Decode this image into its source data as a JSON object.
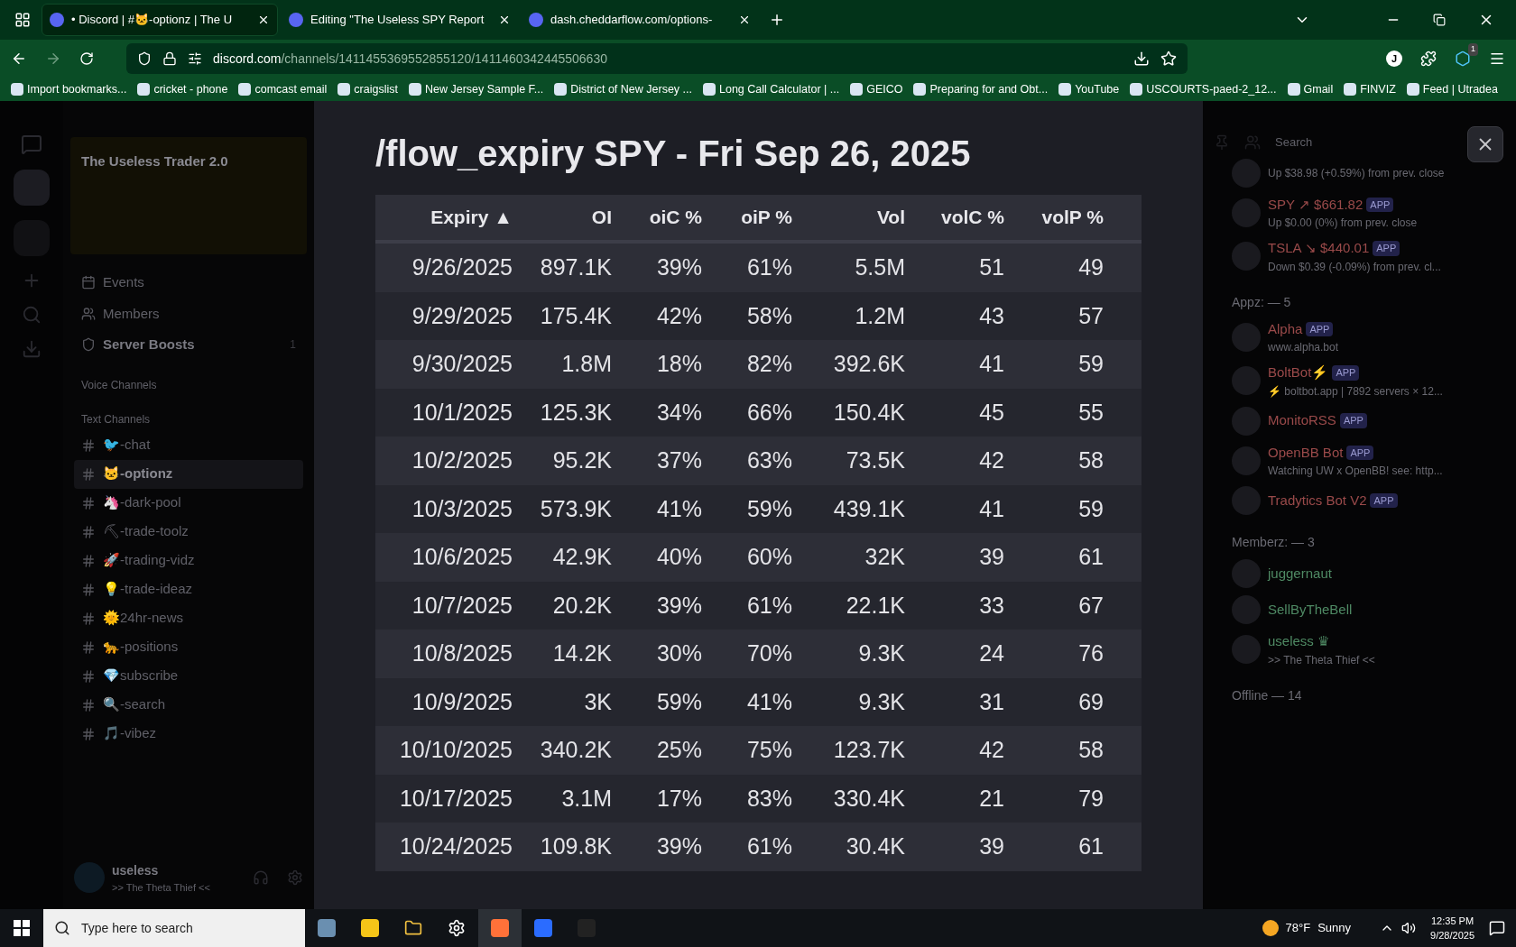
{
  "browser": {
    "tabs": [
      {
        "title": "• Discord | #🐱-optionz | The U",
        "selected": true
      },
      {
        "title": "Editing \"The Useless SPY Report",
        "selected": false
      },
      {
        "title": "dash.cheddarflow.com/options-",
        "selected": false
      }
    ],
    "url": {
      "domain": "discord.com",
      "path": "/channels/1411455369552855120/1411460342445506630"
    },
    "profile": "J",
    "extension_badge": "1",
    "bookmarks": [
      "Import bookmarks...",
      "cricket - phone",
      "comcast email",
      "craigslist",
      "New Jersey Sample F...",
      "District of New Jersey ...",
      "Long Call Calculator | ...",
      "GEICO",
      "Preparing for and Obt...",
      "YouTube",
      "USCOURTS-paed-2_12...",
      "Gmail",
      "FINVIZ",
      "Feed | Utradea"
    ]
  },
  "discord": {
    "server_name": "The Useless Trader 2.0",
    "server_items": [
      {
        "label": "Events"
      },
      {
        "label": "Members"
      },
      {
        "label": "Server Boosts",
        "count": "1"
      }
    ],
    "voice_header": "Voice Channels",
    "text_header": "Text Channels",
    "channels": [
      {
        "name": "🐦-chat",
        "selected": false
      },
      {
        "name": "🐱-optionz",
        "selected": true
      },
      {
        "name": "🦄-dark-pool",
        "selected": false
      },
      {
        "name": "⛏-trade-toolz",
        "selected": false
      },
      {
        "name": "🚀-trading-vidz",
        "selected": false
      },
      {
        "name": "💡-trade-ideaz",
        "selected": false
      },
      {
        "name": "🌞24hr-news",
        "selected": false
      },
      {
        "name": "🐆-positions",
        "selected": false
      },
      {
        "name": "💎subscribe",
        "selected": false
      },
      {
        "name": "🔍-search",
        "selected": false
      },
      {
        "name": "🎵-vibez",
        "selected": false
      }
    ],
    "user": {
      "name": "useless",
      "status": ">> The Theta Thief <<"
    },
    "search_placeholder": "Search",
    "members": [
      {
        "kind": "ticker",
        "sub": "Up $38.98 (+0.59%) from prev. close"
      },
      {
        "kind": "ticker",
        "name": "SPY ↗ $661.82",
        "tag": "APP",
        "sub": "Up $0.00 (0%) from prev. close"
      },
      {
        "kind": "ticker",
        "name": "TSLA ↘ $440.01",
        "tag": "APP",
        "sub": "Down $0.39 (-0.09%) from prev. cl..."
      },
      {
        "kind": "header",
        "name": "Appz: — 5"
      },
      {
        "kind": "app",
        "name": "Alpha",
        "tag": "APP",
        "sub": "www.alpha.bot"
      },
      {
        "kind": "app",
        "name": "BoltBot⚡",
        "tag": "APP",
        "sub": "⚡ boltbot.app | 7892 servers × 12..."
      },
      {
        "kind": "app",
        "name": "MonitoRSS",
        "tag": "APP"
      },
      {
        "kind": "app",
        "name": "OpenBB Bot",
        "tag": "APP",
        "sub": "Watching UW x OpenBB! see: http..."
      },
      {
        "kind": "app",
        "name": "Tradytics Bot V2",
        "tag": "APP"
      },
      {
        "kind": "header",
        "name": "Memberz: — 3"
      },
      {
        "kind": "member",
        "name": "juggernaut"
      },
      {
        "kind": "member",
        "name": "SellByTheBell"
      },
      {
        "kind": "member",
        "name": "useless ♛",
        "sub": ">> The Theta Thief <<"
      },
      {
        "kind": "header",
        "name": "Offline — 14"
      }
    ]
  },
  "modal": {
    "title": "/flow_expiry SPY - Fri Sep 26, 2025",
    "columns": [
      "Expiry ▲",
      "OI",
      "oiC %",
      "oiP %",
      "Vol",
      "volC %",
      "volP %"
    ],
    "rows": [
      [
        "9/26/2025",
        "897.1K",
        "39%",
        "61%",
        "5.5M",
        "51",
        "49"
      ],
      [
        "9/29/2025",
        "175.4K",
        "42%",
        "58%",
        "1.2M",
        "43",
        "57"
      ],
      [
        "9/30/2025",
        "1.8M",
        "18%",
        "82%",
        "392.6K",
        "41",
        "59"
      ],
      [
        "10/1/2025",
        "125.3K",
        "34%",
        "66%",
        "150.4K",
        "45",
        "55"
      ],
      [
        "10/2/2025",
        "95.2K",
        "37%",
        "63%",
        "73.5K",
        "42",
        "58"
      ],
      [
        "10/3/2025",
        "573.9K",
        "41%",
        "59%",
        "439.1K",
        "41",
        "59"
      ],
      [
        "10/6/2025",
        "42.9K",
        "40%",
        "60%",
        "32K",
        "39",
        "61"
      ],
      [
        "10/7/2025",
        "20.2K",
        "39%",
        "61%",
        "22.1K",
        "33",
        "67"
      ],
      [
        "10/8/2025",
        "14.2K",
        "30%",
        "70%",
        "9.3K",
        "24",
        "76"
      ],
      [
        "10/9/2025",
        "3K",
        "59%",
        "41%",
        "9.3K",
        "31",
        "69"
      ],
      [
        "10/10/2025",
        "340.2K",
        "25%",
        "75%",
        "123.7K",
        "42",
        "58"
      ],
      [
        "10/17/2025",
        "3.1M",
        "17%",
        "83%",
        "330.4K",
        "21",
        "79"
      ],
      [
        "10/24/2025",
        "109.8K",
        "39%",
        "61%",
        "30.4K",
        "39",
        "61"
      ]
    ]
  },
  "taskbar": {
    "search_placeholder": "Type here to search",
    "temperature": "78°F",
    "weather": "Sunny",
    "time": "12:35 PM",
    "date": "9/28/2025"
  }
}
